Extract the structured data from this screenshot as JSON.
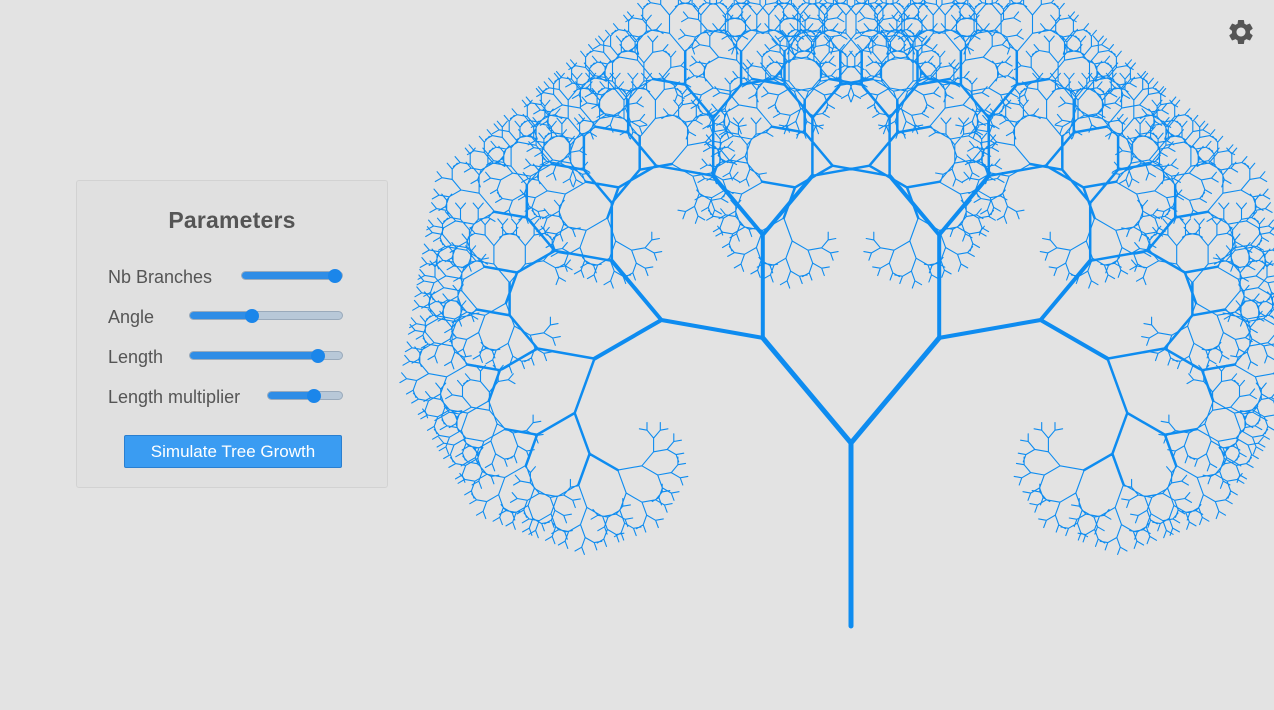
{
  "settings": {
    "icon": "gear-icon"
  },
  "panel": {
    "title": "Parameters",
    "params": [
      {
        "label": "Nb Branches",
        "value": 1.0
      },
      {
        "label": "Angle",
        "value": 0.4
      },
      {
        "label": "Length",
        "value": 0.88
      },
      {
        "label": "Length multiplier",
        "value": 0.65
      }
    ],
    "button_label": "Simulate Tree Growth"
  },
  "tree": {
    "color": "#0e8cf0",
    "depth": 11,
    "angle_deg": 40,
    "length_ratio": 0.75
  },
  "colors": {
    "background": "#e3e3e3",
    "accent": "#1b86ea",
    "text": "#555555"
  }
}
